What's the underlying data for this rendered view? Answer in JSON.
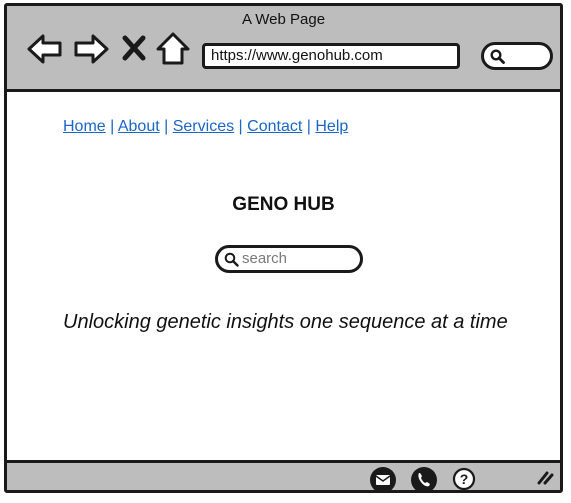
{
  "window": {
    "title": "A Web Page",
    "address": "https://www.genohub.com"
  },
  "toolbar": {
    "icons": [
      "back-arrow-icon",
      "forward-arrow-icon",
      "close-icon",
      "home-icon",
      "search-icon"
    ]
  },
  "nav": {
    "links": [
      "Home",
      "About",
      "Services",
      "Contact",
      "Help"
    ],
    "separator": "|"
  },
  "site": {
    "title": "GENO HUB",
    "search_placeholder": "search",
    "tagline": "Unlocking genetic insights one sequence at a time"
  },
  "statusbar": {
    "icons": [
      "mail-icon",
      "phone-icon",
      "help-icon",
      "resize-grip-icon"
    ]
  },
  "colors": {
    "chrome": "#bdbdbd",
    "link": "#1a66c9",
    "border": "#1a1a1a"
  }
}
